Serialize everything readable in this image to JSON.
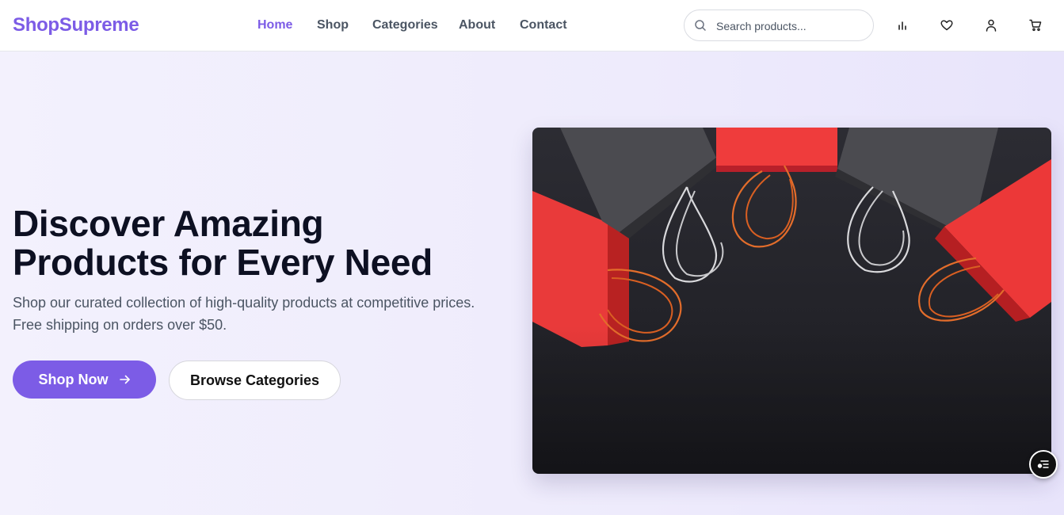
{
  "brand": {
    "name": "ShopSupreme",
    "color": "#7c5ce6"
  },
  "nav": {
    "links": [
      {
        "label": "Home",
        "active": true
      },
      {
        "label": "Shop",
        "active": false
      },
      {
        "label": "Categories",
        "active": false
      },
      {
        "label": "About",
        "active": false
      },
      {
        "label": "Contact",
        "active": false
      }
    ]
  },
  "search": {
    "placeholder": "Search products...",
    "value": "",
    "icon": "search-icon"
  },
  "header_icons": [
    "chart-bar-icon",
    "heart-icon",
    "user-icon",
    "shopping-cart-icon"
  ],
  "hero": {
    "title_line1": "Discover Amazing",
    "title_line2": "Products for Every Need",
    "subtitle_line1": "Shop our curated collection of high-quality products at competitive prices.",
    "subtitle_line2": "Free shipping on orders over $50.",
    "primary_button": {
      "label": "Shop Now",
      "icon": "arrow-right-icon"
    },
    "secondary_button": {
      "label": "Browse Categories"
    },
    "image": {
      "subject": "shopping-bags-photo"
    }
  },
  "floating_button": {
    "icon": "menu-list-icon"
  }
}
